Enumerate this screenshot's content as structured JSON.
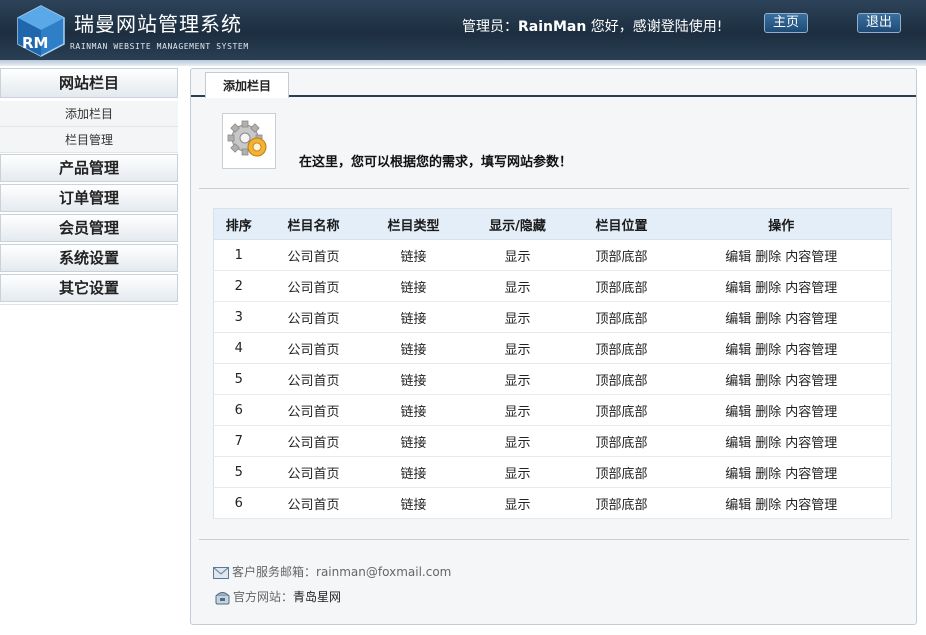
{
  "header": {
    "logo_text": "RM",
    "title": "瑞曼网站管理系统",
    "subtitle": "RAINMAN WEBSITE MANAGEMENT SYSTEM",
    "admin_prefix": "管理员：",
    "admin_name": "RainMan",
    "admin_suffix": " 您好，感谢登陆使用!",
    "home_label": "主页",
    "logout_label": "退出"
  },
  "sidebar": {
    "heading": "网站栏目",
    "sub_items": [
      "添加栏目",
      "栏目管理"
    ],
    "groups": [
      "产品管理",
      "订单管理",
      "会员管理",
      "系统设置",
      "其它设置"
    ]
  },
  "main": {
    "tab_label": "添加栏目",
    "intro_text": "在这里，您可以根据您的需求，填写网站参数！",
    "table": {
      "headers": [
        "排序",
        "栏目名称",
        "栏目类型",
        "显示/隐藏",
        "栏目位置",
        "操作"
      ],
      "rows": [
        {
          "order": "1",
          "name": "公司首页",
          "type": "链接",
          "visible": "显示",
          "position": "顶部底部"
        },
        {
          "order": "2",
          "name": "公司首页",
          "type": "链接",
          "visible": "显示",
          "position": "顶部底部"
        },
        {
          "order": "3",
          "name": "公司首页",
          "type": "链接",
          "visible": "显示",
          "position": "顶部底部"
        },
        {
          "order": "4",
          "name": "公司首页",
          "type": "链接",
          "visible": "显示",
          "position": "顶部底部"
        },
        {
          "order": "5",
          "name": "公司首页",
          "type": "链接",
          "visible": "显示",
          "position": "顶部底部"
        },
        {
          "order": "6",
          "name": "公司首页",
          "type": "链接",
          "visible": "显示",
          "position": "顶部底部"
        },
        {
          "order": "7",
          "name": "公司首页",
          "type": "链接",
          "visible": "显示",
          "position": "顶部底部"
        },
        {
          "order": "5",
          "name": "公司首页",
          "type": "链接",
          "visible": "显示",
          "position": "顶部底部"
        },
        {
          "order": "6",
          "name": "公司首页",
          "type": "链接",
          "visible": "显示",
          "position": "顶部底部"
        }
      ],
      "actions": [
        "编辑",
        "删除",
        "内容管理"
      ]
    }
  },
  "footer": {
    "email_label": "客户服务邮箱：",
    "email": "rainman@foxmail.com",
    "site_label": "官方网站：",
    "site_name": "青岛星网"
  },
  "icons": {
    "logo": "rm-cube-logo",
    "gear": "gear-settings-icon",
    "email": "envelope-icon",
    "site": "phone-icon"
  },
  "colors": {
    "header_bg": "#1c2e40",
    "table_header_bg": "#e3eef8",
    "tab_rule": "#26405a"
  }
}
